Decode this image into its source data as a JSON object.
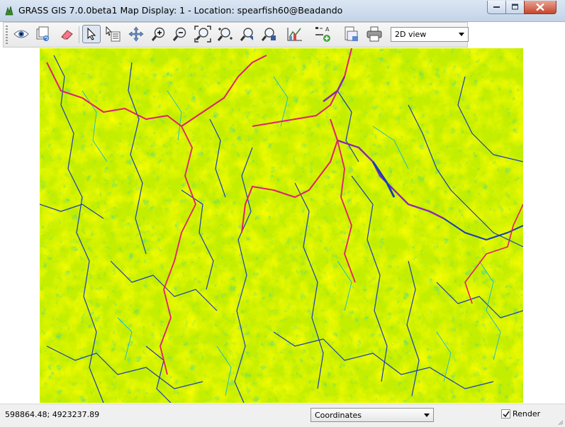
{
  "window": {
    "title": "GRASS GIS 7.0.0beta1 Map Display: 1  - Location: spearfish60@Beadando"
  },
  "toolbar": {
    "tools": [
      {
        "name": "display-map-icon",
        "active": false
      },
      {
        "name": "render-map-icon",
        "active": false
      },
      {
        "name": "erase-display-icon",
        "active": false
      },
      {
        "name": "pointer-icon",
        "active": true
      },
      {
        "name": "query-icon",
        "active": false
      },
      {
        "name": "pan-icon",
        "active": false
      },
      {
        "name": "zoom-in-icon",
        "active": false
      },
      {
        "name": "zoom-out-icon",
        "active": false
      },
      {
        "name": "zoom-extent-icon",
        "active": false
      },
      {
        "name": "zoom-menu-icon",
        "active": false
      },
      {
        "name": "zoom-back-icon",
        "active": false
      },
      {
        "name": "zoom-region-icon",
        "active": false
      },
      {
        "name": "analyze-icon",
        "active": false
      },
      {
        "name": "overlay-icon",
        "active": false
      },
      {
        "name": "save-icon",
        "active": false
      },
      {
        "name": "print-icon",
        "active": false
      }
    ],
    "view_mode": "2D view"
  },
  "map": {
    "description_colors": {
      "background": "#c8f000",
      "ridge": "#ffff00",
      "stream": "#1a3ab0",
      "stream_light": "#00b8e8",
      "major_stream": "#e0206a",
      "major_stream_alt": "#8a2ab0"
    }
  },
  "status": {
    "coordinates": "598864.48; 4923237.89",
    "mode": "Coordinates",
    "render_label": "Render",
    "render_checked": true
  }
}
